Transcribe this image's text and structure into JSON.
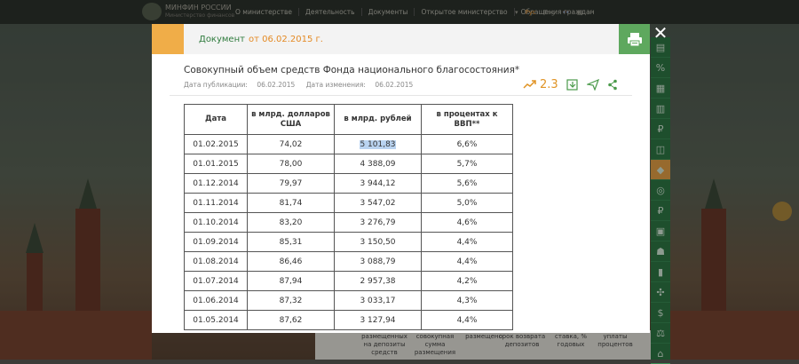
{
  "site": {
    "brand": "МИНФИН РОССИИ",
    "brand_sub": "Министерство финансов",
    "nav": [
      "О министерстве",
      "Деятельность",
      "Документы",
      "Открытое министерство",
      "Обращения граждан"
    ],
    "lang_ru": "Рус",
    "lang_en": "Eng",
    "bg_table_headers": [
      "размещенных на депозиты средств",
      "совокупная сумма размещения",
      "размещено",
      "срок возврата депозитов",
      "ставка, % годовых",
      "уплаты процентов"
    ]
  },
  "modal": {
    "doc_label": "Документ",
    "doc_date": "от 06.02.2015 г.",
    "title": "Совокупный объем средств Фонда национального благосостояния*",
    "pub_label": "Дата публикации:",
    "pub_date": "06.02.2015",
    "mod_label": "Дата изменения:",
    "mod_date": "06.02.2015",
    "views": "2.3",
    "table": {
      "headers": [
        "Дата",
        "в млрд. долларов США",
        "в млрд. рублей",
        "в процентах к ВВП**"
      ],
      "rows": [
        [
          "01.02.2015",
          "74,02",
          "5 101,83",
          "6,6%"
        ],
        [
          "01.01.2015",
          "78,00",
          "4 388,09",
          "5,7%"
        ],
        [
          "01.12.2014",
          "79,97",
          "3 944,12",
          "5,6%"
        ],
        [
          "01.11.2014",
          "81,74",
          "3 547,02",
          "5,0%"
        ],
        [
          "01.10.2014",
          "83,20",
          "3 276,79",
          "4,6%"
        ],
        [
          "01.09.2014",
          "85,31",
          "3 150,50",
          "4,4%"
        ],
        [
          "01.08.2014",
          "86,46",
          "3 088,79",
          "4,4%"
        ],
        [
          "01.07.2014",
          "87,94",
          "2 957,38",
          "4,2%"
        ],
        [
          "01.06.2014",
          "87,32",
          "3 033,17",
          "4,3%"
        ],
        [
          "01.05.2014",
          "87,62",
          "3 127,94",
          "4,4%"
        ]
      ],
      "selected_cell": "5 101,83"
    }
  },
  "icons": {
    "print": "printer-icon",
    "close": "close-icon",
    "trend": "trend-icon",
    "export": "export-icon",
    "send": "send-icon",
    "share": "share-icon"
  },
  "colors": {
    "accent_orange": "#f0ad48",
    "green": "#2f7b3d",
    "print_green": "#5ea85e",
    "date_orange": "#e48a24",
    "selection": "#b9d3f0"
  }
}
